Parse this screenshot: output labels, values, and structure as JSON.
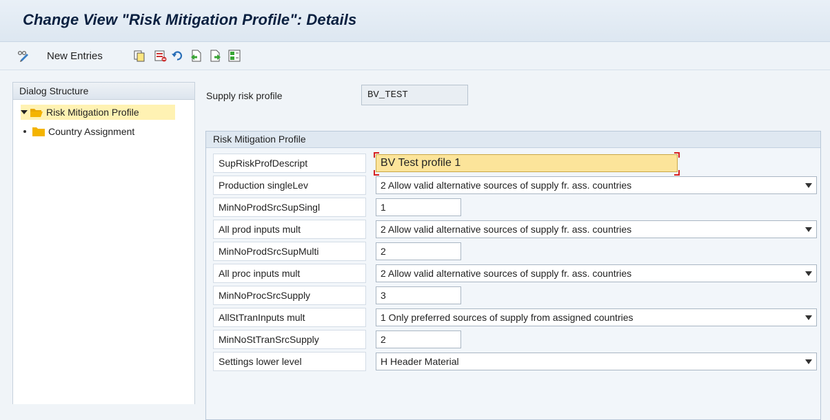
{
  "window": {
    "title": "Change View \"Risk Mitigation Profile\": Details"
  },
  "toolbar": {
    "new_entries_label": "New Entries",
    "icons": [
      "display-change-icon",
      "copy-icon",
      "delete-icon",
      "undo-icon",
      "previous-entry-icon",
      "next-entry-icon",
      "select-all-icon"
    ]
  },
  "dialog_structure": {
    "header": "Dialog Structure",
    "items": [
      {
        "label": "Risk Mitigation Profile",
        "expanded": true,
        "selected": true
      },
      {
        "label": "Country Assignment",
        "expanded": false,
        "selected": false
      }
    ]
  },
  "header_field": {
    "label": "Supply risk profile",
    "value": "BV_TEST"
  },
  "group": {
    "title": "Risk Mitigation Profile",
    "rows": [
      {
        "label": "SupRiskProfDescript",
        "type": "text",
        "value": "BV Test profile 1",
        "focused": true
      },
      {
        "label": "Production singleLev",
        "type": "select",
        "value": "2 Allow valid alternative sources of supply fr. ass. countries"
      },
      {
        "label": "MinNoProdSrcSupSingl",
        "type": "number",
        "value": "1"
      },
      {
        "label": "All prod inputs mult",
        "type": "select",
        "value": "2 Allow valid alternative sources of supply fr. ass. countries"
      },
      {
        "label": "MinNoProdSrcSupMulti",
        "type": "number",
        "value": "2"
      },
      {
        "label": "All proc inputs mult",
        "type": "select",
        "value": "2 Allow valid alternative sources of supply fr. ass. countries"
      },
      {
        "label": "MinNoProcSrcSupply",
        "type": "number",
        "value": "3"
      },
      {
        "label": "AllStTranInputs mult",
        "type": "select",
        "value": "1 Only preferred sources of supply from assigned countries"
      },
      {
        "label": "MinNoStTranSrcSupply",
        "type": "number",
        "value": "2"
      },
      {
        "label": "Settings lower level",
        "type": "select",
        "value": "H Header Material"
      }
    ]
  },
  "colors": {
    "title": "#0a2040",
    "folder": "#f4b400",
    "focus_field": "#fce49a",
    "selected_tree": "#fff2b3"
  }
}
